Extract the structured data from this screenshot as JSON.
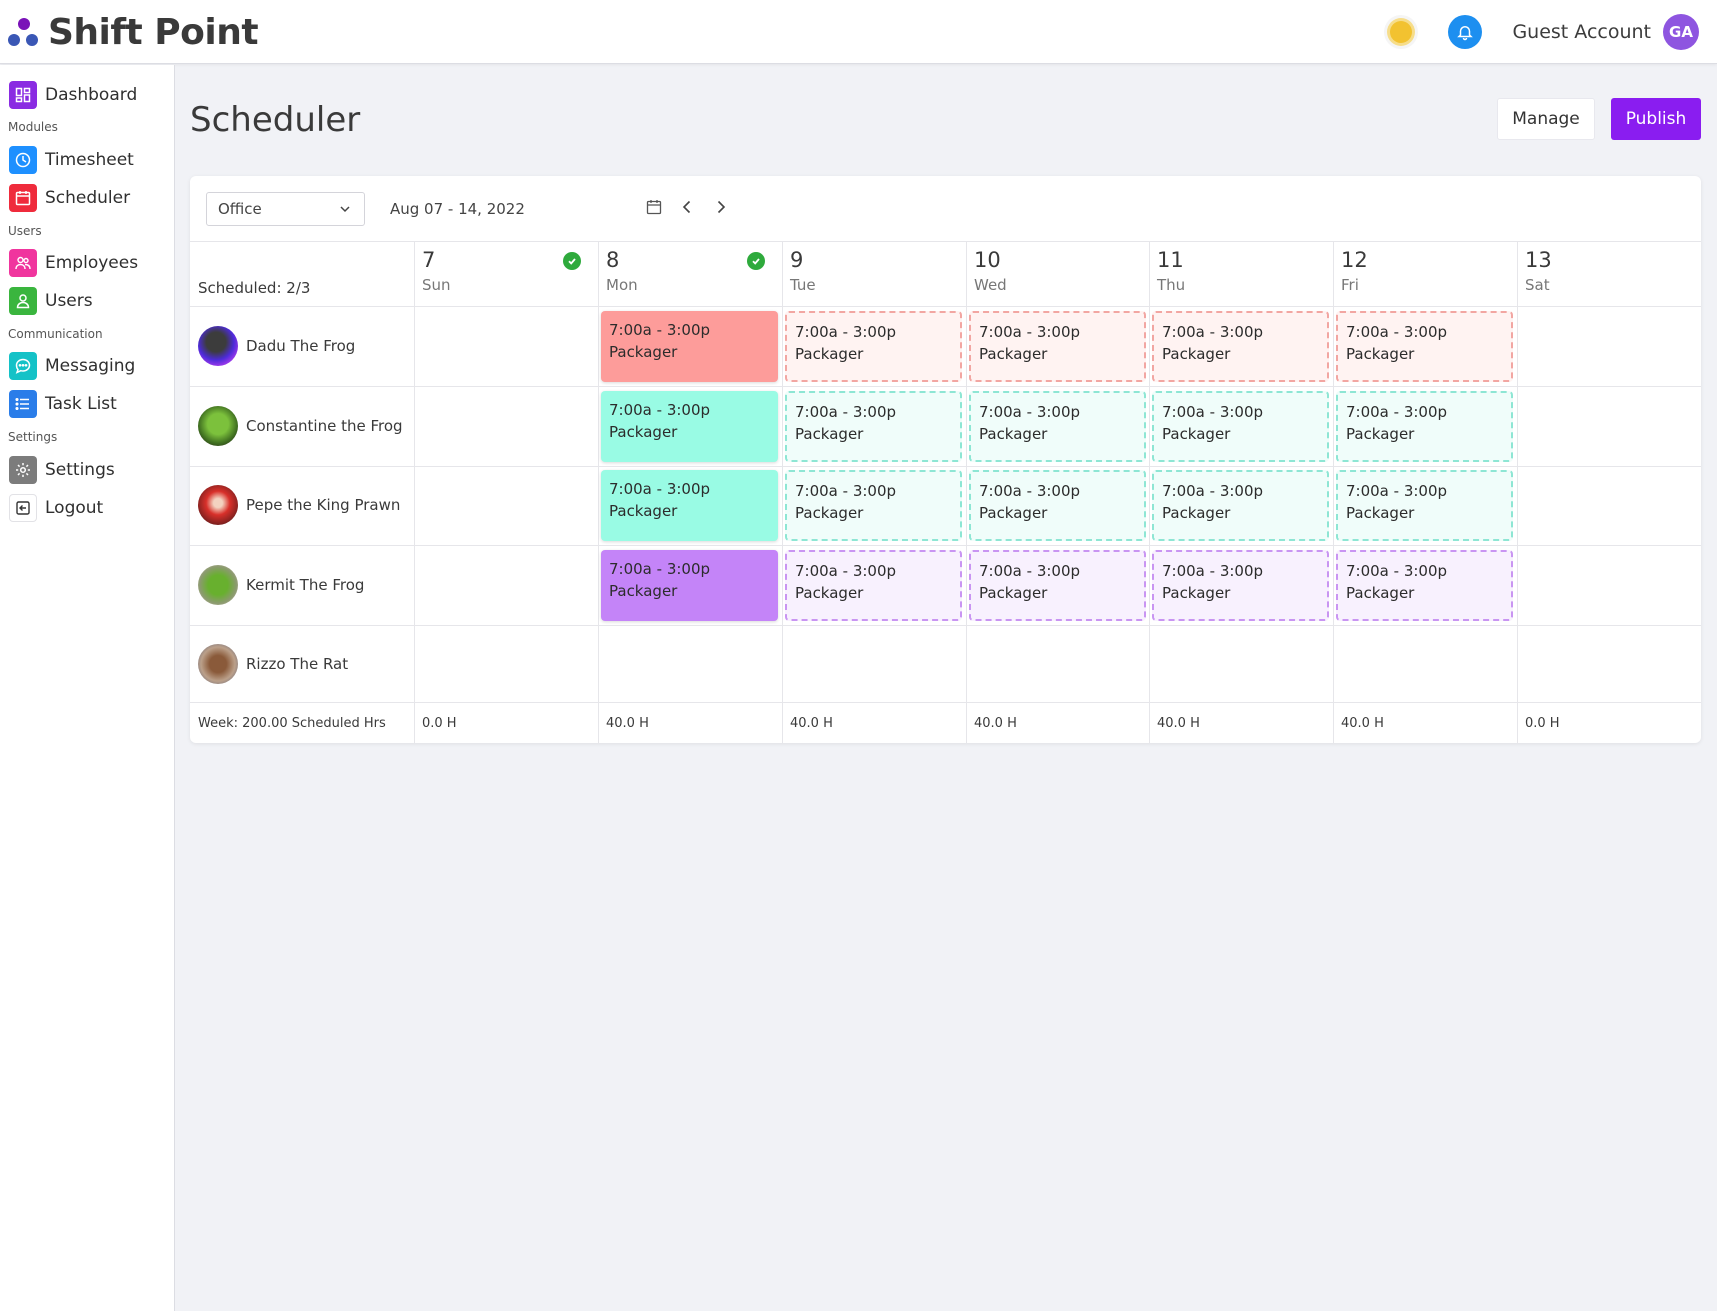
{
  "app": {
    "name": "Shift Point",
    "account_name": "Guest Account",
    "account_initials": "GA"
  },
  "sidebar": {
    "dashboard": "Dashboard",
    "section_modules": "Modules",
    "timesheet": "Timesheet",
    "scheduler": "Scheduler",
    "section_users": "Users",
    "employees": "Employees",
    "users": "Users",
    "section_communication": "Communication",
    "messaging": "Messaging",
    "task_list": "Task List",
    "section_settings": "Settings",
    "settings": "Settings",
    "logout": "Logout"
  },
  "page": {
    "title": "Scheduler",
    "manage_label": "Manage",
    "publish_label": "Publish"
  },
  "toolbar": {
    "location": "Office",
    "date_range": "Aug 07 - 14, 2022"
  },
  "schedule": {
    "scheduled_label": "Scheduled: 2/3",
    "days": [
      {
        "num": "7",
        "name": "Sun",
        "checked": true,
        "hours": "0.0 H"
      },
      {
        "num": "8",
        "name": "Mon",
        "checked": true,
        "hours": "40.0 H"
      },
      {
        "num": "9",
        "name": "Tue",
        "checked": false,
        "hours": "40.0 H"
      },
      {
        "num": "10",
        "name": "Wed",
        "checked": false,
        "hours": "40.0 H"
      },
      {
        "num": "11",
        "name": "Thu",
        "checked": false,
        "hours": "40.0 H"
      },
      {
        "num": "12",
        "name": "Fri",
        "checked": false,
        "hours": "40.0 H"
      },
      {
        "num": "13",
        "name": "Sat",
        "checked": false,
        "hours": "0.0 H"
      }
    ],
    "employees": [
      {
        "name": "Dadu The Frog",
        "shift_time": "7:00a - 3:00p",
        "role": "Packager"
      },
      {
        "name": "Constantine the Frog",
        "shift_time": "7:00a - 3:00p",
        "role": "Packager"
      },
      {
        "name": "Pepe the King Prawn",
        "shift_time": "7:00a - 3:00p",
        "role": "Packager"
      },
      {
        "name": "Kermit The Frog",
        "shift_time": "7:00a - 3:00p",
        "role": "Packager"
      },
      {
        "name": "Rizzo The Rat"
      }
    ],
    "week_total": "Week: 200.00 Scheduled Hrs"
  },
  "colors": {
    "brand": "#8a1df0",
    "shift_red": "#fd9c9a",
    "shift_teal": "#99fbe4",
    "shift_purple": "#c484f8"
  }
}
